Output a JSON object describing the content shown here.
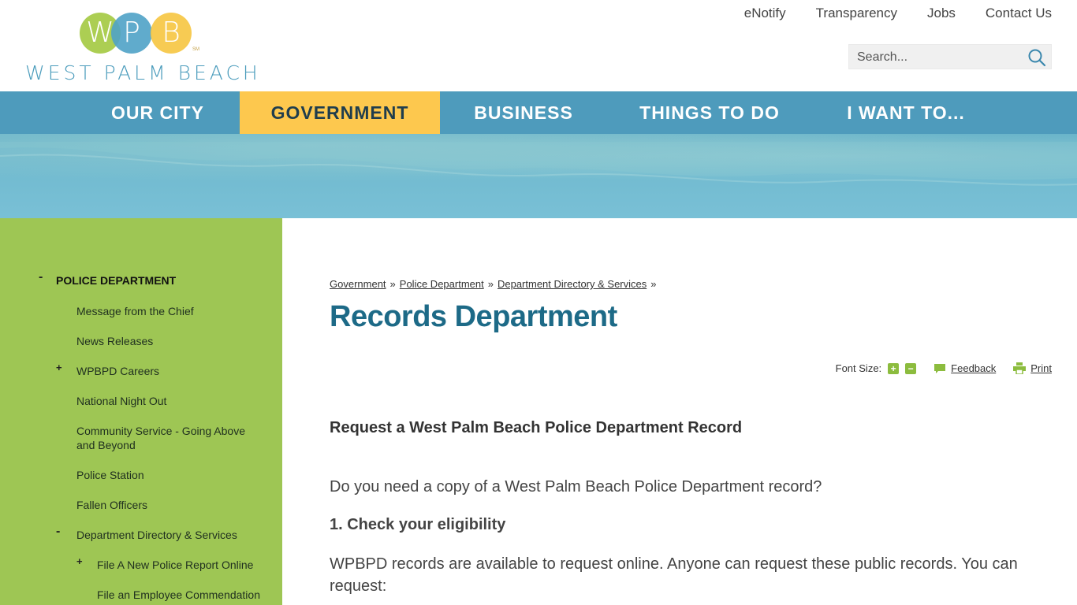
{
  "logo": {
    "letters": [
      "W",
      "P",
      "B"
    ],
    "wordmark": "WEST PALM BEACH",
    "sm": "SM"
  },
  "utility_links": [
    "eNotify",
    "Transparency",
    "Jobs",
    "Contact Us"
  ],
  "search": {
    "placeholder": "Search..."
  },
  "nav": {
    "items": [
      "OUR CITY",
      "GOVERNMENT",
      "BUSINESS",
      "THINGS TO DO",
      "I WANT TO..."
    ],
    "active": "GOVERNMENT"
  },
  "sidebar": {
    "top_item": {
      "toggle": "-",
      "label": "POLICE DEPARTMENT"
    },
    "items": [
      {
        "toggle": "",
        "label": "Message from the Chief"
      },
      {
        "toggle": "",
        "label": "News Releases"
      },
      {
        "toggle": "+",
        "label": "WPBPD Careers"
      },
      {
        "toggle": "",
        "label": "National Night Out"
      },
      {
        "toggle": "",
        "label": "Community Service - Going Above and Beyond"
      },
      {
        "toggle": "",
        "label": "Police Station"
      },
      {
        "toggle": "",
        "label": "Fallen Officers"
      },
      {
        "toggle": "-",
        "label": "Department Directory & Services"
      }
    ],
    "subitems": [
      {
        "toggle": "+",
        "label": "File A New Police Report Online"
      },
      {
        "toggle": "",
        "label": "File an Employee Commendation"
      }
    ]
  },
  "breadcrumb": {
    "items": [
      "Government",
      "Police Department",
      "Department Directory & Services"
    ],
    "separator": "»"
  },
  "page_title": "Records Department",
  "tools": {
    "font_size_label": "Font Size:",
    "increase": "+",
    "decrease": "−",
    "feedback_label": "Feedback",
    "print_label": "Print"
  },
  "content": {
    "heading": "Request a West Palm Beach Police Department Record",
    "intro": "Do you need a copy of a West Palm Beach Police Department record?",
    "step1": "1. Check your eligibility",
    "step1_text": "WPBPD records are available to request online. Anyone can request these public records. You can request:"
  },
  "colors": {
    "nav_bg": "#4e9bbc",
    "nav_active": "#fdc84e",
    "sidebar_bg": "#9ec654",
    "title": "#1d6a87"
  }
}
